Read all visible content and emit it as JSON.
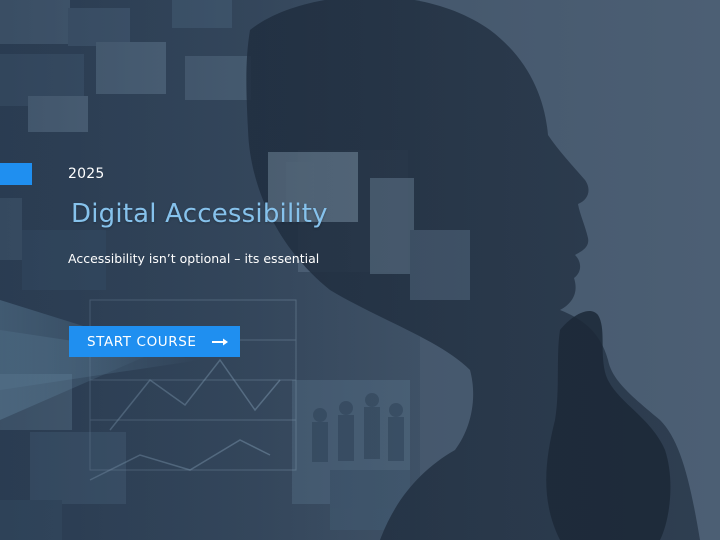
{
  "course": {
    "year": "2025",
    "title": "Digital Accessibility",
    "subtitle": "Accessibility isn’t optional – its essential"
  },
  "actions": {
    "start_label": "START  COURSE",
    "start_icon": "arrow-right-icon"
  },
  "background": {
    "image": "woman-profile-with-media-collage",
    "overlay_color": "#3a4d62"
  },
  "colors": {
    "accent": "#1f8ff0",
    "title": "#86c2ec",
    "text": "#ffffff"
  }
}
